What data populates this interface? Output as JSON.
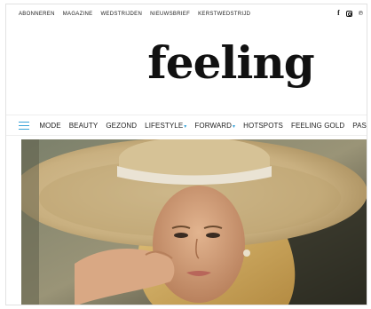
{
  "topbar": {
    "links": [
      "ABONNEREN",
      "MAGAZINE",
      "WEDSTRIJDEN",
      "NIEUWSBRIEF",
      "KERSTWEDSTRIJD"
    ],
    "social_icons": [
      "facebook-icon",
      "instagram-icon",
      "pinterest-icon"
    ],
    "facebook_glyph": "f",
    "pinterest_glyph": "℗"
  },
  "logo": {
    "text": "feeling"
  },
  "nav": {
    "items": [
      {
        "label": "MODE",
        "dropdown": false
      },
      {
        "label": "BEAUTY",
        "dropdown": false
      },
      {
        "label": "GEZOND",
        "dropdown": false
      },
      {
        "label": "LIFESTYLE",
        "dropdown": true
      },
      {
        "label": "FORWARD",
        "dropdown": true
      },
      {
        "label": "HOTSPOTS",
        "dropdown": false
      },
      {
        "label": "FEELING GOLD",
        "dropdown": false
      },
      {
        "label": "PAS",
        "dropdown": false
      }
    ],
    "caret": "▾",
    "accent": "#3aa3d8"
  },
  "hero": {
    "alt": ""
  }
}
